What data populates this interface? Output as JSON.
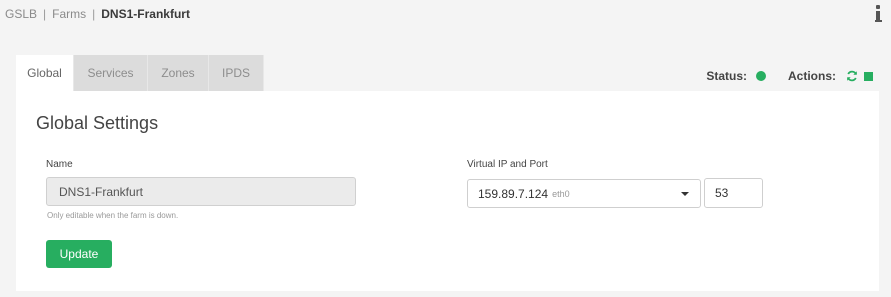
{
  "breadcrumb": {
    "items": [
      "GSLB",
      "Farms"
    ],
    "separator": "|",
    "current": "DNS1-Frankfurt"
  },
  "header": {
    "info_icon": "info-icon"
  },
  "tabs": [
    {
      "label": "Global",
      "active": true
    },
    {
      "label": "Services",
      "active": false
    },
    {
      "label": "Zones",
      "active": false
    },
    {
      "label": "IPDS",
      "active": false
    }
  ],
  "status": {
    "label": "Status:",
    "state_color": "#27ae60",
    "actions_label": "Actions:",
    "action_icons": [
      "refresh-icon",
      "stop-icon"
    ]
  },
  "panel": {
    "title": "Global Settings",
    "name": {
      "label": "Name",
      "value": "DNS1-Frankfurt",
      "help": "Only editable when the farm is down."
    },
    "vip": {
      "label": "Virtual IP and Port",
      "ip": "159.89.7.124",
      "interface": "eth0",
      "port": "53"
    },
    "update_label": "Update"
  },
  "colors": {
    "accent": "#27ae60",
    "tab_inactive": "#dcdcdc",
    "background": "#f4f4f4"
  }
}
